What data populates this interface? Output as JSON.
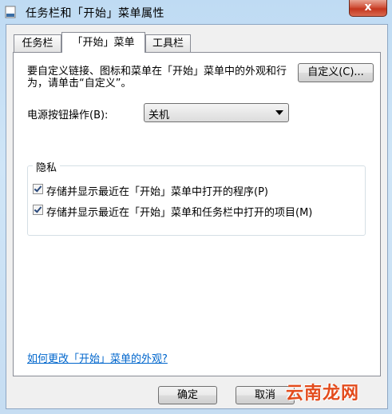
{
  "window": {
    "title": "任务栏和「开始」菜单属性",
    "close_glyph": "x"
  },
  "tabs": [
    {
      "label": "任务栏"
    },
    {
      "label": "「开始」菜单"
    },
    {
      "label": "工具栏"
    }
  ],
  "start_menu": {
    "description": "要自定义链接、图标和菜单在「开始」菜单中的外观和行为，请单击“自定义”。",
    "customize_button": "自定义(C)...",
    "power_label": "电源按钮操作(B):",
    "power_value": "关机",
    "privacy": {
      "title": "隐私",
      "items": [
        {
          "label": "存储并显示最近在「开始」菜单中打开的程序(P)",
          "checked": true
        },
        {
          "label": "存储并显示最近在「开始」菜单和任务栏中打开的项目(M)",
          "checked": true
        }
      ]
    },
    "help_link": "如何更改「开始」菜单的外观?"
  },
  "footer": {
    "ok": "确定",
    "cancel": "取消"
  },
  "watermark": {
    "text": "云南龙网"
  }
}
